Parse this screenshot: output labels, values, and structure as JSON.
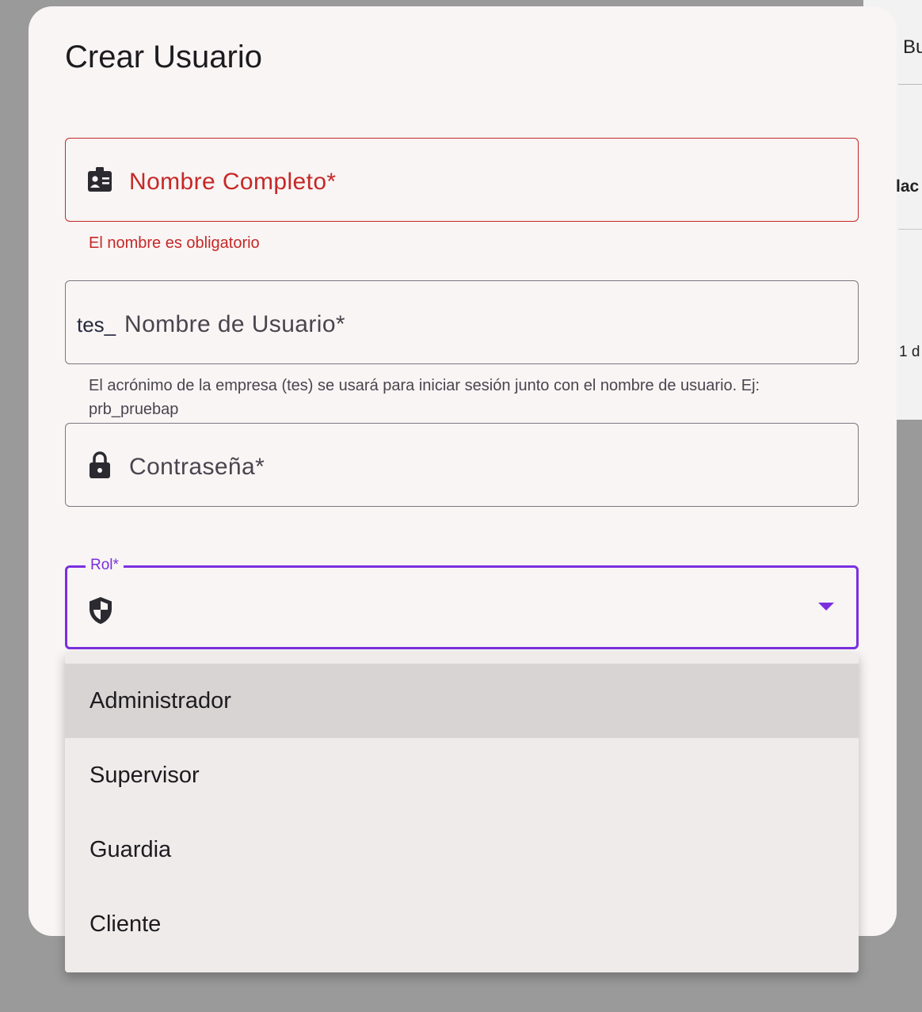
{
  "background": {
    "text_top": "Bu",
    "text_middle": "lac",
    "text_bottom": "1 d"
  },
  "dialog": {
    "title": "Crear Usuario"
  },
  "fields": {
    "full_name": {
      "label": "Nombre Completo*",
      "icon": "id-badge-icon",
      "error": "El nombre es obligatorio"
    },
    "username": {
      "prefix": "tes_",
      "label": "Nombre de Usuario*",
      "helper": "El acrónimo de la empresa (tes) se usará para iniciar sesión junto con el nombre de usuario. Ej: prb_pruebap"
    },
    "password": {
      "label": "Contraseña*",
      "icon": "lock-icon"
    },
    "role": {
      "label": "Rol*",
      "icon": "shield-icon",
      "value": ""
    }
  },
  "role_menu": {
    "options": [
      "Administrador",
      "Supervisor",
      "Guardia",
      "Cliente"
    ],
    "highlighted": "Administrador"
  },
  "colors": {
    "error": "#c62828",
    "focus": "#7b2fe0",
    "dialog_bg": "#f8f5f4",
    "menu_bg": "#efebea",
    "menu_highlight": "#d8d4d3"
  }
}
